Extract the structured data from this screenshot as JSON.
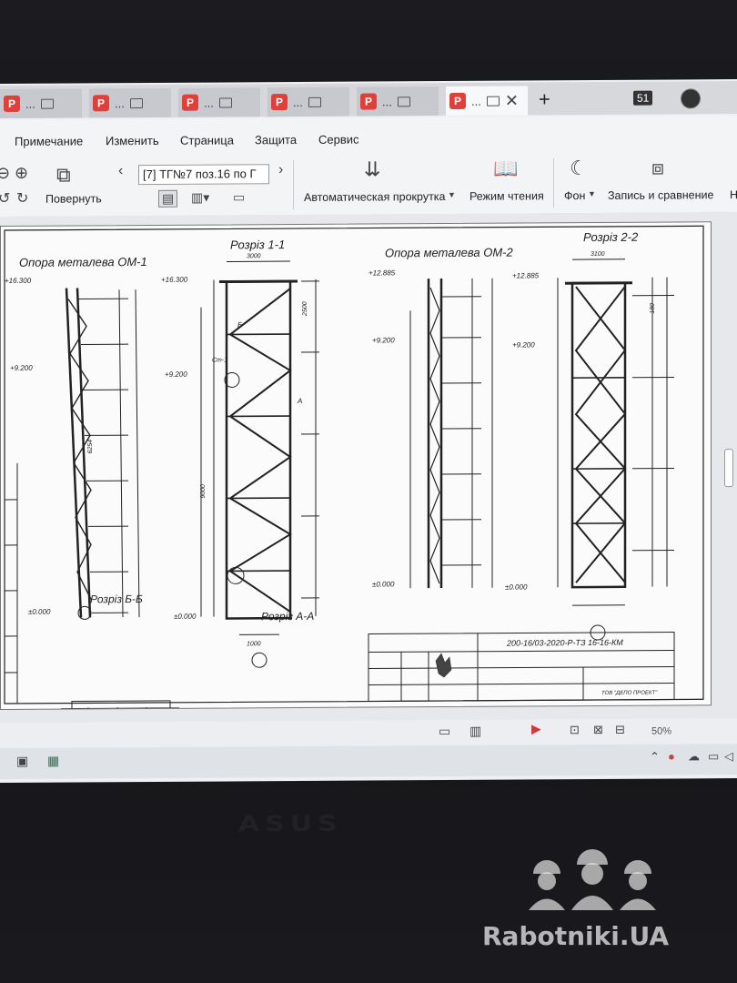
{
  "tabs": [
    {
      "label": "..."
    },
    {
      "label": "..."
    },
    {
      "label": "..."
    },
    {
      "label": "..."
    },
    {
      "label": "..."
    },
    {
      "label": "..."
    }
  ],
  "tabbar": {
    "new_tab": "+",
    "counter_badge": "51"
  },
  "menu": [
    "Примечание",
    "Изменить",
    "Страница",
    "Защита",
    "Сервис"
  ],
  "toolbar": {
    "rotate_label": "Повернуть",
    "page_field": "[7] ТГ№7 поз.16 по Г",
    "autoscroll_label": "Автоматическая прокрутка",
    "reading_mode_label": "Режим чтения",
    "background_label": "Фон",
    "record_compare_label": "Запись и сравнение",
    "cut_label": "Н"
  },
  "drawing": {
    "title_om1": "Опора металева ОМ-1",
    "title_section11": "Розріз 1-1",
    "title_om2": "Опора металева ОМ-2",
    "title_section22": "Розріз 2-2",
    "title_sectionBB": "Розріз Б-Б",
    "title_sectionAA": "Розріз А-А",
    "level_top1": "+16.300",
    "level_top2": "+12.885",
    "level_mid": "+9.200",
    "level_zero": "±0.000",
    "dim_3000": "3000",
    "dim_2500": "2500",
    "dim_9000": "9000",
    "dim_6254": "6254",
    "dim_3100": "3100",
    "dim_1000": "1000",
    "dim_180": "180",
    "label_b1": "Б",
    "label_a": "А",
    "label_cp": "Ст-1",
    "stamp_code": "200-16/03-2020-Р-ТЗ 16-16-КМ",
    "company": "ТОВ \"ДЕПО ПРОЕКТ\""
  },
  "statusbar": {
    "zoom": "50%"
  },
  "laptop_brand": "ASUS",
  "watermark": "Rabotniki.UA"
}
